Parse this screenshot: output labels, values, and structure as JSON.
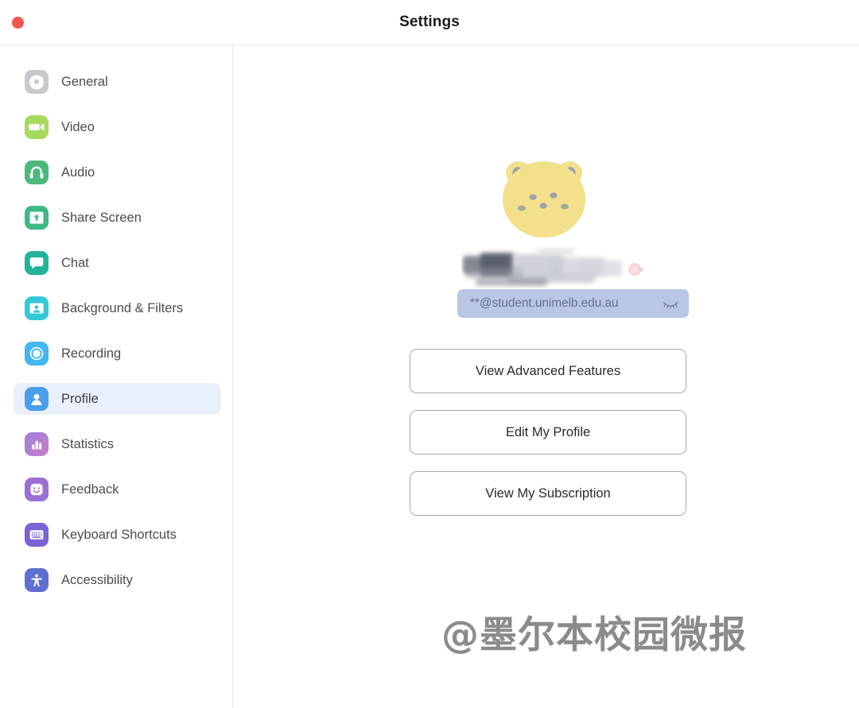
{
  "window": {
    "title": "Settings",
    "close_button": "close",
    "accent_close_color": "#f3554c"
  },
  "sidebar": {
    "items": [
      {
        "label": "General",
        "icon": "gear-icon",
        "color": "#c7c7cc",
        "active": false
      },
      {
        "label": "Video",
        "icon": "video-camera-icon",
        "color": "#a8d95f",
        "active": false
      },
      {
        "label": "Audio",
        "icon": "headphones-icon",
        "color": "#4cb97a",
        "active": false
      },
      {
        "label": "Share Screen",
        "icon": "share-screen-icon",
        "color": "#3fb885",
        "active": false
      },
      {
        "label": "Chat",
        "icon": "chat-bubble-icon",
        "color": "#23b39a",
        "active": false
      },
      {
        "label": "Background & Filters",
        "icon": "background-filters-icon",
        "color": "#35c9d8",
        "active": false
      },
      {
        "label": "Recording",
        "icon": "record-circle-icon",
        "color": "#45b6f0",
        "active": false
      },
      {
        "label": "Profile",
        "icon": "person-icon",
        "color": "#4a9eeb",
        "active": true
      },
      {
        "label": "Statistics",
        "icon": "bar-chart-icon",
        "color": "#b munched",
        "active": false
      },
      {
        "label": "Feedback",
        "icon": "smiley-face-icon",
        "color": "#9b6fd4",
        "active": false
      },
      {
        "label": "Keyboard Shortcuts",
        "icon": "keyboard-icon",
        "color": "#7b63d6",
        "active": false
      },
      {
        "label": "Accessibility",
        "icon": "accessibility-icon",
        "color": "#5f6fd0",
        "active": false
      }
    ]
  },
  "profile": {
    "avatar_alt": "yellow-bear-avatar",
    "display_name_redacted": true,
    "email": "**@student.unimelb.edu.au",
    "email_hidden_toggle": "hide-email-icon",
    "buttons": [
      {
        "label": "View Advanced Features"
      },
      {
        "label": "Edit My Profile"
      },
      {
        "label": "View My Subscription"
      }
    ]
  },
  "watermark": {
    "text": "@墨尔本校园微报"
  }
}
